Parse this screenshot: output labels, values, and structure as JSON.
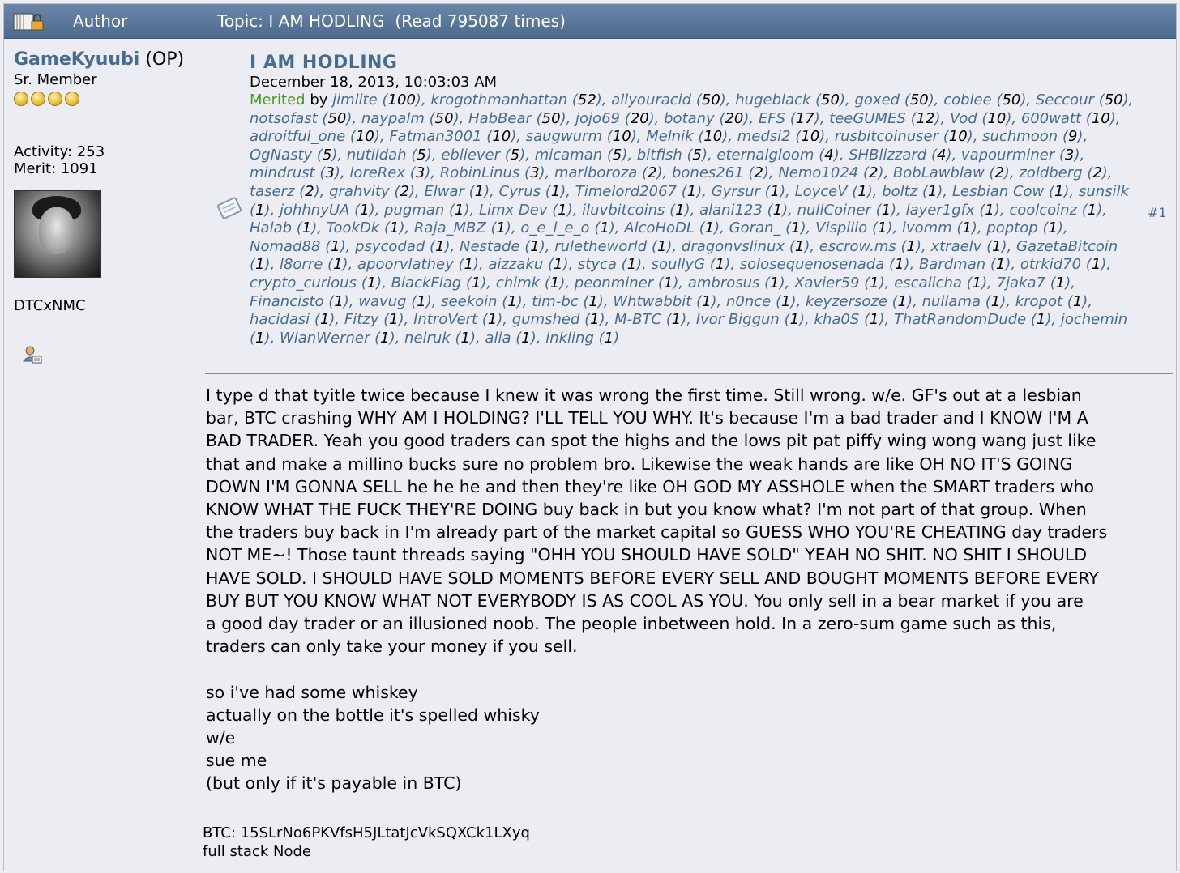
{
  "header": {
    "author_label": "Author",
    "topic_text": "Topic: I AM HODLING  (Read 795087 times)"
  },
  "poster": {
    "name": "GameKyuubi",
    "op_tag": "(OP)",
    "rank": "Sr. Member",
    "star_count": 4,
    "activity": "Activity: 253",
    "merit": "Merit: 1091",
    "signature_name": "DTCxNMC"
  },
  "post": {
    "title": "I AM HODLING",
    "date": "December 18, 2013, 10:03:03 AM",
    "merited_label": "Merited",
    "by_label": "by",
    "number": "#1",
    "merits": [
      [
        "jimlite",
        "100"
      ],
      [
        "krogothmanhattan",
        "52"
      ],
      [
        "allyouracid",
        "50"
      ],
      [
        "hugeblack",
        "50"
      ],
      [
        "goxed",
        "50"
      ],
      [
        "coblee",
        "50"
      ],
      [
        "Seccour",
        "50"
      ],
      [
        "notsofast",
        "50"
      ],
      [
        "naypalm",
        "50"
      ],
      [
        "HabBear",
        "50"
      ],
      [
        "jojo69",
        "20"
      ],
      [
        "botany",
        "20"
      ],
      [
        "EFS",
        "17"
      ],
      [
        "teeGUMES",
        "12"
      ],
      [
        "Vod",
        "10"
      ],
      [
        "600watt",
        "10"
      ],
      [
        "adroitful_one",
        "10"
      ],
      [
        "Fatman3001",
        "10"
      ],
      [
        "saugwurm",
        "10"
      ],
      [
        "Melnik",
        "10"
      ],
      [
        "medsi2",
        "10"
      ],
      [
        "rusbitcoinuser",
        "10"
      ],
      [
        "suchmoon",
        "9"
      ],
      [
        "OgNasty",
        "5"
      ],
      [
        "nutildah",
        "5"
      ],
      [
        "ebliever",
        "5"
      ],
      [
        "micaman",
        "5"
      ],
      [
        "bitfish",
        "5"
      ],
      [
        "eternalgloom",
        "4"
      ],
      [
        "SHBlizzard",
        "4"
      ],
      [
        "vapourminer",
        "3"
      ],
      [
        "mindrust",
        "3"
      ],
      [
        "loreRex",
        "3"
      ],
      [
        "RobinLinus",
        "3"
      ],
      [
        "marlboroza",
        "2"
      ],
      [
        "bones261",
        "2"
      ],
      [
        "Nemo1024",
        "2"
      ],
      [
        "BobLawblaw",
        "2"
      ],
      [
        "zoldberg",
        "2"
      ],
      [
        "taserz",
        "2"
      ],
      [
        "grahvity",
        "2"
      ],
      [
        "Elwar",
        "1"
      ],
      [
        "Cyrus",
        "1"
      ],
      [
        "Timelord2067",
        "1"
      ],
      [
        "Gyrsur",
        "1"
      ],
      [
        "LoyceV",
        "1"
      ],
      [
        "boltz",
        "1"
      ],
      [
        "Lesbian Cow",
        "1"
      ],
      [
        "sunsilk",
        "1"
      ],
      [
        "johhnyUA",
        "1"
      ],
      [
        "pugman",
        "1"
      ],
      [
        "Limx Dev",
        "1"
      ],
      [
        "iluvbitcoins",
        "1"
      ],
      [
        "alani123",
        "1"
      ],
      [
        "nullCoiner",
        "1"
      ],
      [
        "layer1gfx",
        "1"
      ],
      [
        "coolcoinz",
        "1"
      ],
      [
        "Halab",
        "1"
      ],
      [
        "TookDk",
        "1"
      ],
      [
        "Raja_MBZ",
        "1"
      ],
      [
        "o_e_l_e_o",
        "1"
      ],
      [
        "AlcoHoDL",
        "1"
      ],
      [
        "Goran_",
        "1"
      ],
      [
        "Vispilio",
        "1"
      ],
      [
        "ivomm",
        "1"
      ],
      [
        "poptop",
        "1"
      ],
      [
        "Nomad88",
        "1"
      ],
      [
        "psycodad",
        "1"
      ],
      [
        "Nestade",
        "1"
      ],
      [
        "ruletheworld",
        "1"
      ],
      [
        "dragonvslinux",
        "1"
      ],
      [
        "escrow.ms",
        "1"
      ],
      [
        "xtraelv",
        "1"
      ],
      [
        "GazetaBitcoin",
        "1"
      ],
      [
        "l8orre",
        "1"
      ],
      [
        "apoorvlathey",
        "1"
      ],
      [
        "aizzaku",
        "1"
      ],
      [
        "styca",
        "1"
      ],
      [
        "soullyG",
        "1"
      ],
      [
        "solosequenosenada",
        "1"
      ],
      [
        "Bardman",
        "1"
      ],
      [
        "otrkid70",
        "1"
      ],
      [
        "crypto_curious",
        "1"
      ],
      [
        "BlackFlag",
        "1"
      ],
      [
        "chimk",
        "1"
      ],
      [
        "peonminer",
        "1"
      ],
      [
        "ambrosus",
        "1"
      ],
      [
        "Xavier59",
        "1"
      ],
      [
        "escalicha",
        "1"
      ],
      [
        "7jaka7",
        "1"
      ],
      [
        "Financisto",
        "1"
      ],
      [
        "wavug",
        "1"
      ],
      [
        "seekoin",
        "1"
      ],
      [
        "tim-bc",
        "1"
      ],
      [
        "Whtwabbit",
        "1"
      ],
      [
        "n0nce",
        "1"
      ],
      [
        "keyzersoze",
        "1"
      ],
      [
        "nullama",
        "1"
      ],
      [
        "kropot",
        "1"
      ],
      [
        "hacidasi",
        "1"
      ],
      [
        "Fitzy",
        "1"
      ],
      [
        "IntroVert",
        "1"
      ],
      [
        "gumshed",
        "1"
      ],
      [
        "M-BTC",
        "1"
      ],
      [
        "Ivor Biggun",
        "1"
      ],
      [
        "kha0S",
        "1"
      ],
      [
        "ThatRandomDude",
        "1"
      ],
      [
        "jochemin",
        "1"
      ],
      [
        "WlanWerner",
        "1"
      ],
      [
        "nelruk",
        "1"
      ],
      [
        "alia",
        "1"
      ],
      [
        "inkling",
        "1"
      ]
    ],
    "body_lines": [
      "I type d that tyitle twice because I knew it was wrong the first time.  Still wrong.  w/e.  GF's out at a lesbian",
      "bar, BTC crashing WHY AM I HOLDING? I'LL TELL YOU WHY.  It's because I'm a bad trader and I KNOW I'M A",
      "BAD TRADER.  Yeah you good traders can spot the highs and the lows pit pat piffy wing wong wang just like",
      "that and make a millino bucks sure no problem bro.  Likewise the weak hands are like OH NO IT'S GOING",
      "DOWN I'M GONNA SELL he he he and then they're like OH GOD MY ASSHOLE when the SMART traders who",
      "KNOW WHAT THE FUCK THEY'RE DOING buy back in but you know what?  I'm not part of that group.  When",
      "the traders buy back in I'm already part of the market capital so GUESS WHO YOU'RE CHEATING day traders",
      "NOT ME~!  Those taunt threads saying \"OHH YOU SHOULD HAVE SOLD\" YEAH NO SHIT.  NO SHIT I SHOULD",
      "HAVE SOLD.  I SHOULD HAVE SOLD MOMENTS BEFORE EVERY SELL AND BOUGHT MOMENTS BEFORE EVERY",
      "BUY BUT YOU KNOW WHAT NOT EVERYBODY IS AS COOL AS YOU.  You only sell in a bear market if you are",
      "a good day trader or an illusioned noob.  The people inbetween hold.  In a zero-sum game such as this,",
      "traders can only take your money if you sell."
    ],
    "whiskey_lines": [
      "so i've had some whiskey",
      "actually on the bottle it's spelled whisky",
      "w/e",
      "sue me",
      "(but only if it's payable in BTC)"
    ]
  },
  "signature": {
    "btc": "BTC: 15SLrNo6PKVfsH5JLtatJcVkSQXCk1LXyq",
    "node": "full stack Node"
  },
  "colors": {
    "header_bg": "#5a7599",
    "link": "#476c8e",
    "merited": "#4a9a1e",
    "page_bg": "#ecedf3"
  }
}
